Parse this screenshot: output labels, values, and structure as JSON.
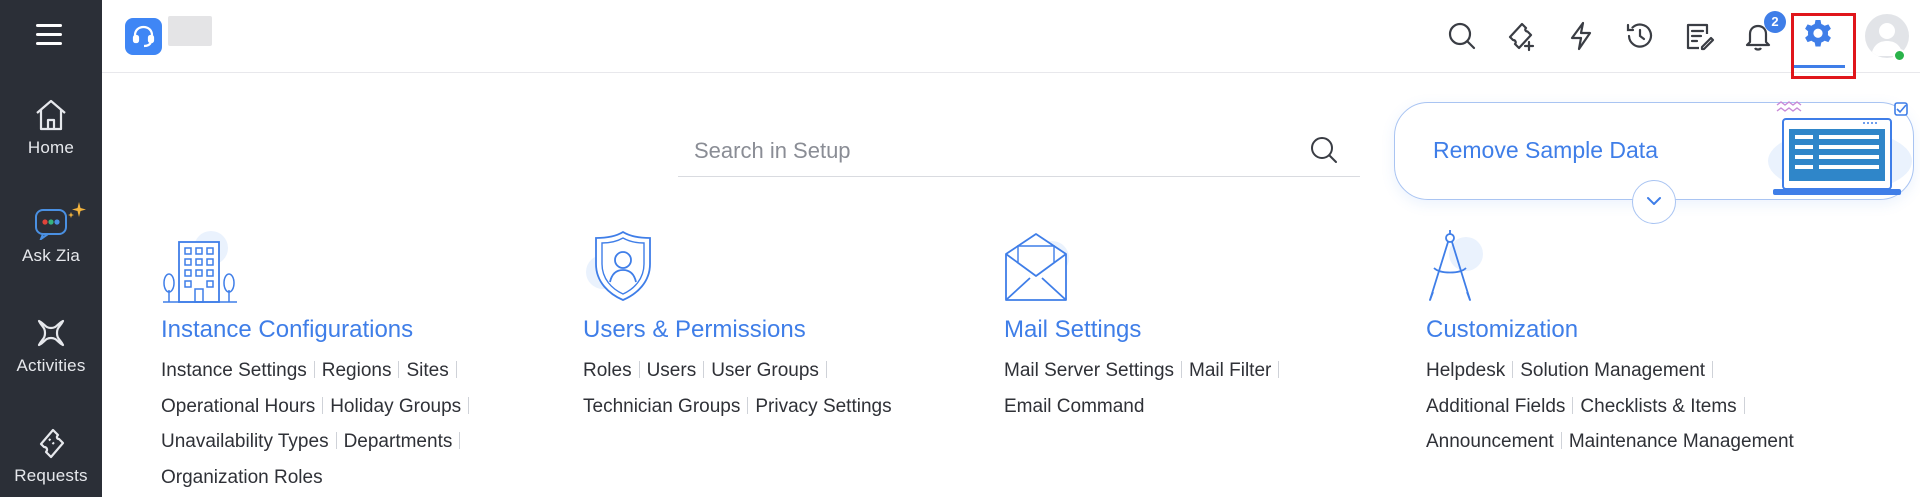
{
  "sidebar": {
    "items": [
      {
        "label": "Home",
        "icon": "home-icon"
      },
      {
        "label": "Ask Zia",
        "icon": "zia-icon"
      },
      {
        "label": "Activities",
        "icon": "activities-icon"
      },
      {
        "label": "Requests",
        "icon": "requests-icon"
      }
    ]
  },
  "topbar": {
    "notification_count": "2",
    "icons": [
      "search-icon",
      "new-ticket-icon",
      "quick-actions-icon",
      "history-icon",
      "tasks-icon",
      "bell-icon",
      "gear-icon",
      "avatar"
    ]
  },
  "search": {
    "placeholder": "Search in Setup"
  },
  "sample_card": {
    "link_label": "Remove Sample Data"
  },
  "categories": [
    {
      "title": "Instance Configurations",
      "icon": "building-icon",
      "links": [
        "Instance Settings",
        "Regions",
        "Sites",
        "Operational Hours",
        "Holiday Groups",
        "Unavailability Types",
        "Departments",
        "Organization Roles"
      ]
    },
    {
      "title": "Users & Permissions",
      "icon": "user-shield-icon",
      "links": [
        "Roles",
        "Users",
        "User Groups",
        "Technician Groups",
        "Privacy Settings"
      ]
    },
    {
      "title": "Mail Settings",
      "icon": "mail-icon",
      "links": [
        "Mail Server Settings",
        "Mail Filter",
        "Email Command"
      ]
    },
    {
      "title": "Customization",
      "icon": "compass-icon",
      "links": [
        "Helpdesk",
        "Solution Management",
        "Additional Fields",
        "Checklists & Items",
        "Announcement",
        "Maintenance Management"
      ]
    }
  ],
  "colors": {
    "sidebar_bg": "#2b2f37",
    "accent": "#3f7ee8",
    "highlight_box": "#e0161b",
    "online_status": "#2ab34a"
  }
}
